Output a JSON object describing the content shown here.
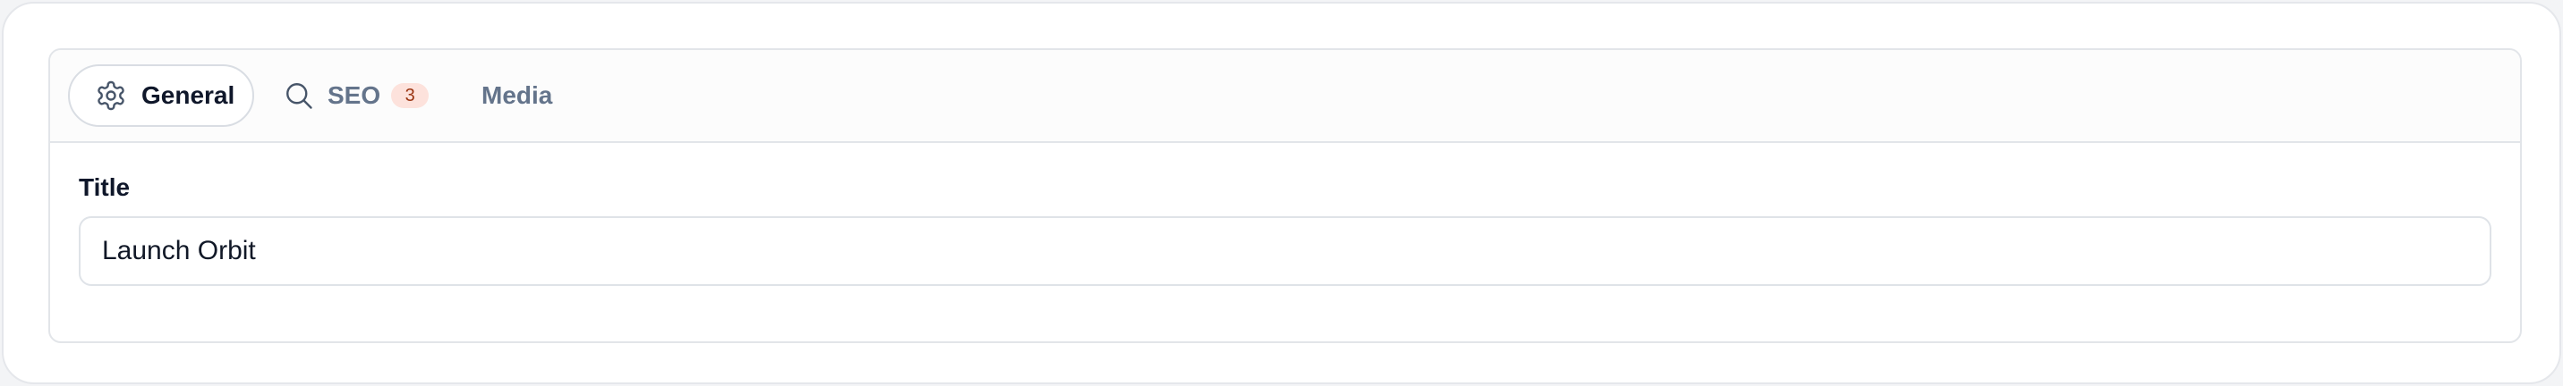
{
  "tabs": [
    {
      "label": "General",
      "icon": "gear-icon",
      "active": true
    },
    {
      "label": "SEO",
      "icon": "search-icon",
      "badge": "3",
      "active": false
    },
    {
      "label": "Media",
      "active": false
    }
  ],
  "form": {
    "title_label": "Title",
    "title_value": "Launch Orbit"
  },
  "colors": {
    "active_text": "#0f172a",
    "inactive_text": "#64748b",
    "badge_bg": "#fde2dc",
    "badge_text": "#9a3412",
    "border": "#e2e5e9"
  }
}
